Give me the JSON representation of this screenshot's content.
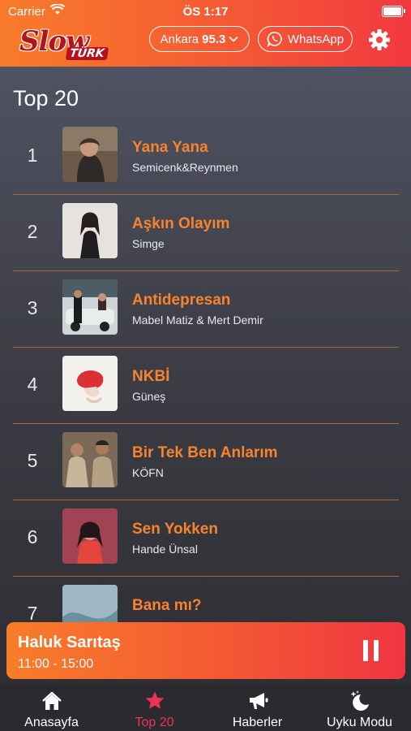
{
  "status_bar": {
    "carrier": "Carrier",
    "time": "ÖS 1:17",
    "battery_level": 1.0
  },
  "header": {
    "logo_main": "Slow",
    "logo_sub": "TÜRK",
    "city": "Ankara",
    "frequency": "95.3",
    "whatsapp_label": "WhatsApp",
    "icons": {
      "city_dropdown": "chevron-down-icon",
      "whatsapp": "whatsapp-icon",
      "settings": "gear-icon"
    }
  },
  "page": {
    "title": "Top 20"
  },
  "chart": [
    {
      "rank": "1",
      "title": "Yana Yana",
      "artist": "Semicenk&Reynmen"
    },
    {
      "rank": "2",
      "title": "Aşkın Olayım",
      "artist": "Simge"
    },
    {
      "rank": "3",
      "title": "Antidepresan",
      "artist": "Mabel Matiz & Mert Demir"
    },
    {
      "rank": "4",
      "title": "NKBİ",
      "artist": "Güneş"
    },
    {
      "rank": "5",
      "title": "Bir Tek Ben Anlarım",
      "artist": "KÖFN"
    },
    {
      "rank": "6",
      "title": "Sen Yokken",
      "artist": "Hande Ünsal"
    },
    {
      "rank": "7",
      "title": "Bana mı?",
      "artist": ""
    }
  ],
  "player": {
    "program": "Haluk Sarıtaş",
    "time_range": "11:00 - 15:00",
    "state": "playing",
    "control_icon": "pause-icon"
  },
  "tabbar": {
    "tabs": [
      {
        "label": "Anasayfa",
        "icon": "home-icon"
      },
      {
        "label": "Top 20",
        "icon": "star-icon",
        "active": true
      },
      {
        "label": "Haberler",
        "icon": "megaphone-icon"
      },
      {
        "label": "Uyku Modu",
        "icon": "moon-stars-icon"
      }
    ]
  },
  "colors": {
    "accent": "#f7832f",
    "header_start": "#f77b2a",
    "header_end": "#f1383f",
    "active_tab": "#f0325a",
    "divider": "#b26335"
  }
}
